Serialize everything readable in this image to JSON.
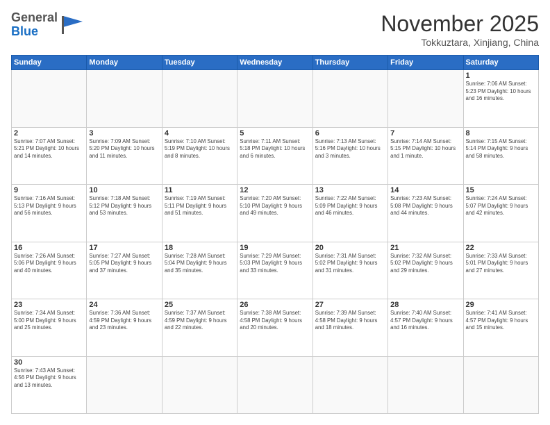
{
  "header": {
    "logo_general": "General",
    "logo_blue": "Blue",
    "month_title": "November 2025",
    "location": "Tokkuztara, Xinjiang, China"
  },
  "weekdays": [
    "Sunday",
    "Monday",
    "Tuesday",
    "Wednesday",
    "Thursday",
    "Friday",
    "Saturday"
  ],
  "weeks": [
    [
      {
        "day": "",
        "info": ""
      },
      {
        "day": "",
        "info": ""
      },
      {
        "day": "",
        "info": ""
      },
      {
        "day": "",
        "info": ""
      },
      {
        "day": "",
        "info": ""
      },
      {
        "day": "",
        "info": ""
      },
      {
        "day": "1",
        "info": "Sunrise: 7:06 AM\nSunset: 5:23 PM\nDaylight: 10 hours\nand 16 minutes."
      }
    ],
    [
      {
        "day": "2",
        "info": "Sunrise: 7:07 AM\nSunset: 5:21 PM\nDaylight: 10 hours\nand 14 minutes."
      },
      {
        "day": "3",
        "info": "Sunrise: 7:09 AM\nSunset: 5:20 PM\nDaylight: 10 hours\nand 11 minutes."
      },
      {
        "day": "4",
        "info": "Sunrise: 7:10 AM\nSunset: 5:19 PM\nDaylight: 10 hours\nand 8 minutes."
      },
      {
        "day": "5",
        "info": "Sunrise: 7:11 AM\nSunset: 5:18 PM\nDaylight: 10 hours\nand 6 minutes."
      },
      {
        "day": "6",
        "info": "Sunrise: 7:13 AM\nSunset: 5:16 PM\nDaylight: 10 hours\nand 3 minutes."
      },
      {
        "day": "7",
        "info": "Sunrise: 7:14 AM\nSunset: 5:15 PM\nDaylight: 10 hours\nand 1 minute."
      },
      {
        "day": "8",
        "info": "Sunrise: 7:15 AM\nSunset: 5:14 PM\nDaylight: 9 hours\nand 58 minutes."
      }
    ],
    [
      {
        "day": "9",
        "info": "Sunrise: 7:16 AM\nSunset: 5:13 PM\nDaylight: 9 hours\nand 56 minutes."
      },
      {
        "day": "10",
        "info": "Sunrise: 7:18 AM\nSunset: 5:12 PM\nDaylight: 9 hours\nand 53 minutes."
      },
      {
        "day": "11",
        "info": "Sunrise: 7:19 AM\nSunset: 5:11 PM\nDaylight: 9 hours\nand 51 minutes."
      },
      {
        "day": "12",
        "info": "Sunrise: 7:20 AM\nSunset: 5:10 PM\nDaylight: 9 hours\nand 49 minutes."
      },
      {
        "day": "13",
        "info": "Sunrise: 7:22 AM\nSunset: 5:09 PM\nDaylight: 9 hours\nand 46 minutes."
      },
      {
        "day": "14",
        "info": "Sunrise: 7:23 AM\nSunset: 5:08 PM\nDaylight: 9 hours\nand 44 minutes."
      },
      {
        "day": "15",
        "info": "Sunrise: 7:24 AM\nSunset: 5:07 PM\nDaylight: 9 hours\nand 42 minutes."
      }
    ],
    [
      {
        "day": "16",
        "info": "Sunrise: 7:26 AM\nSunset: 5:06 PM\nDaylight: 9 hours\nand 40 minutes."
      },
      {
        "day": "17",
        "info": "Sunrise: 7:27 AM\nSunset: 5:05 PM\nDaylight: 9 hours\nand 37 minutes."
      },
      {
        "day": "18",
        "info": "Sunrise: 7:28 AM\nSunset: 5:04 PM\nDaylight: 9 hours\nand 35 minutes."
      },
      {
        "day": "19",
        "info": "Sunrise: 7:29 AM\nSunset: 5:03 PM\nDaylight: 9 hours\nand 33 minutes."
      },
      {
        "day": "20",
        "info": "Sunrise: 7:31 AM\nSunset: 5:02 PM\nDaylight: 9 hours\nand 31 minutes."
      },
      {
        "day": "21",
        "info": "Sunrise: 7:32 AM\nSunset: 5:02 PM\nDaylight: 9 hours\nand 29 minutes."
      },
      {
        "day": "22",
        "info": "Sunrise: 7:33 AM\nSunset: 5:01 PM\nDaylight: 9 hours\nand 27 minutes."
      }
    ],
    [
      {
        "day": "23",
        "info": "Sunrise: 7:34 AM\nSunset: 5:00 PM\nDaylight: 9 hours\nand 25 minutes."
      },
      {
        "day": "24",
        "info": "Sunrise: 7:36 AM\nSunset: 4:59 PM\nDaylight: 9 hours\nand 23 minutes."
      },
      {
        "day": "25",
        "info": "Sunrise: 7:37 AM\nSunset: 4:59 PM\nDaylight: 9 hours\nand 22 minutes."
      },
      {
        "day": "26",
        "info": "Sunrise: 7:38 AM\nSunset: 4:58 PM\nDaylight: 9 hours\nand 20 minutes."
      },
      {
        "day": "27",
        "info": "Sunrise: 7:39 AM\nSunset: 4:58 PM\nDaylight: 9 hours\nand 18 minutes."
      },
      {
        "day": "28",
        "info": "Sunrise: 7:40 AM\nSunset: 4:57 PM\nDaylight: 9 hours\nand 16 minutes."
      },
      {
        "day": "29",
        "info": "Sunrise: 7:41 AM\nSunset: 4:57 PM\nDaylight: 9 hours\nand 15 minutes."
      }
    ],
    [
      {
        "day": "30",
        "info": "Sunrise: 7:43 AM\nSunset: 4:56 PM\nDaylight: 9 hours\nand 13 minutes."
      },
      {
        "day": "",
        "info": ""
      },
      {
        "day": "",
        "info": ""
      },
      {
        "day": "",
        "info": ""
      },
      {
        "day": "",
        "info": ""
      },
      {
        "day": "",
        "info": ""
      },
      {
        "day": "",
        "info": ""
      }
    ]
  ]
}
